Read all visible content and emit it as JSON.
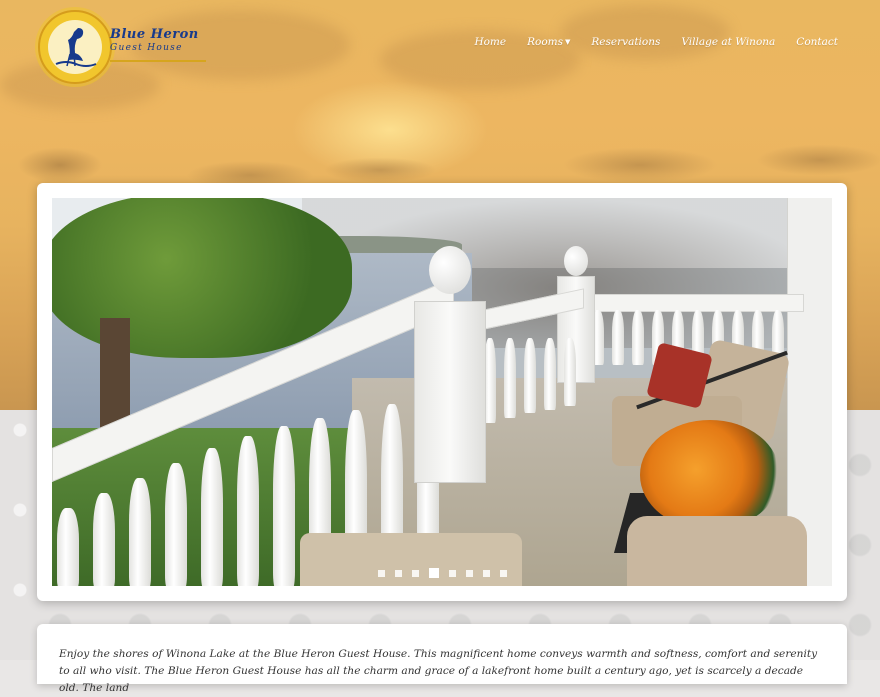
{
  "brand": {
    "name_line1": "Blue Heron",
    "name_line2": "Guest House",
    "logo_icon": "heron-icon"
  },
  "nav": {
    "items": [
      {
        "label": "Home"
      },
      {
        "label": "Rooms",
        "has_dropdown": true
      },
      {
        "label": "Reservations"
      },
      {
        "label": "Village at Winona"
      },
      {
        "label": "Contact"
      }
    ]
  },
  "slider": {
    "image": "porch with balustrade overlooking lake, wicker chairs and orange flowers",
    "slide_count": 8,
    "active_index": 3
  },
  "intro": {
    "text": "Enjoy the shores of Winona Lake at the Blue Heron Guest House. This magnificent home conveys warmth and softness, comfort and serenity to all who visit. The Blue Heron Guest House has all the charm and grace of a lakefront home built a century ago, yet is scarcely a decade old. The land"
  },
  "colors": {
    "sunset": "#e9b760",
    "brand_blue": "#173a8c",
    "logo_gold": "#f1c62d",
    "nav_text": "#ffffff"
  }
}
